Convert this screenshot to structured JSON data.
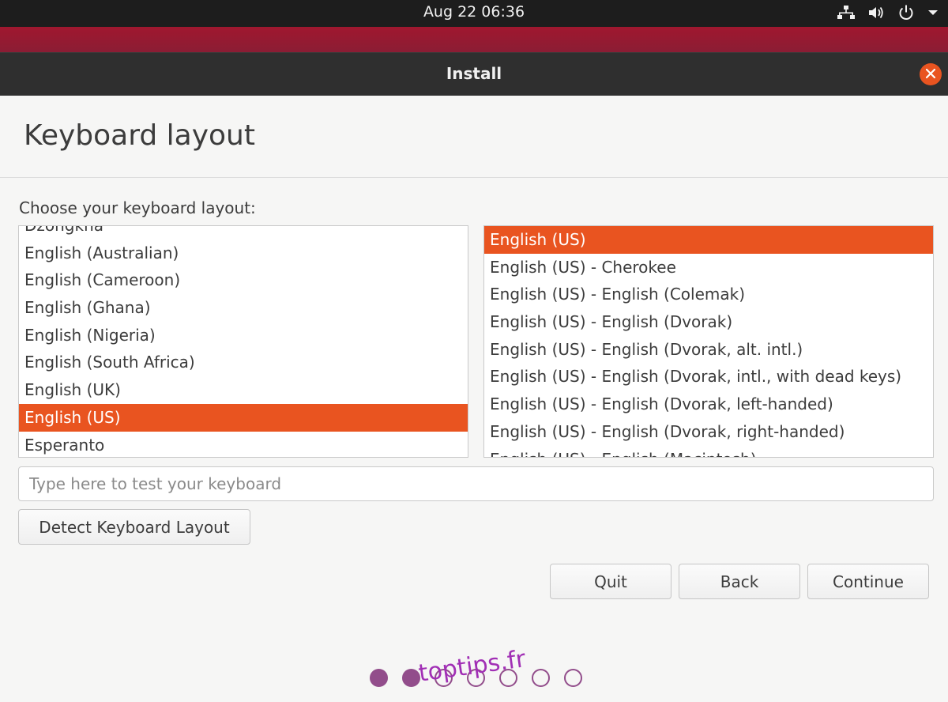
{
  "topbar": {
    "clock": "Aug 22  06:36",
    "icons": [
      "network-icon",
      "volume-icon",
      "power-icon",
      "chevron-down-icon"
    ]
  },
  "window": {
    "title": "Install",
    "close_icon": "close-icon",
    "accent_color": "#e95420"
  },
  "page": {
    "heading": "Keyboard layout",
    "choose_label": "Choose your keyboard layout:"
  },
  "layouts": {
    "items": [
      "Dzongkha",
      "English (Australian)",
      "English (Cameroon)",
      "English (Ghana)",
      "English (Nigeria)",
      "English (South Africa)",
      "English (UK)",
      "English (US)",
      "Esperanto"
    ],
    "selected": "English (US)"
  },
  "variants": {
    "items": [
      "English (US)",
      "English (US) - Cherokee",
      "English (US) - English (Colemak)",
      "English (US) - English (Dvorak)",
      "English (US) - English (Dvorak, alt. intl.)",
      "English (US) - English (Dvorak, intl., with dead keys)",
      "English (US) - English (Dvorak, left-handed)",
      "English (US) - English (Dvorak, right-handed)",
      "English (US) - English (Macintosh)"
    ],
    "selected": "English (US)"
  },
  "test_field": {
    "placeholder": "Type here to test your keyboard",
    "value": ""
  },
  "buttons": {
    "detect": "Detect Keyboard Layout",
    "quit": "Quit",
    "back": "Back",
    "continue": "Continue"
  },
  "progress": {
    "total_steps": 7,
    "completed_steps": 2,
    "dot_color": "#924d8b"
  },
  "watermark": "toptips.fr"
}
